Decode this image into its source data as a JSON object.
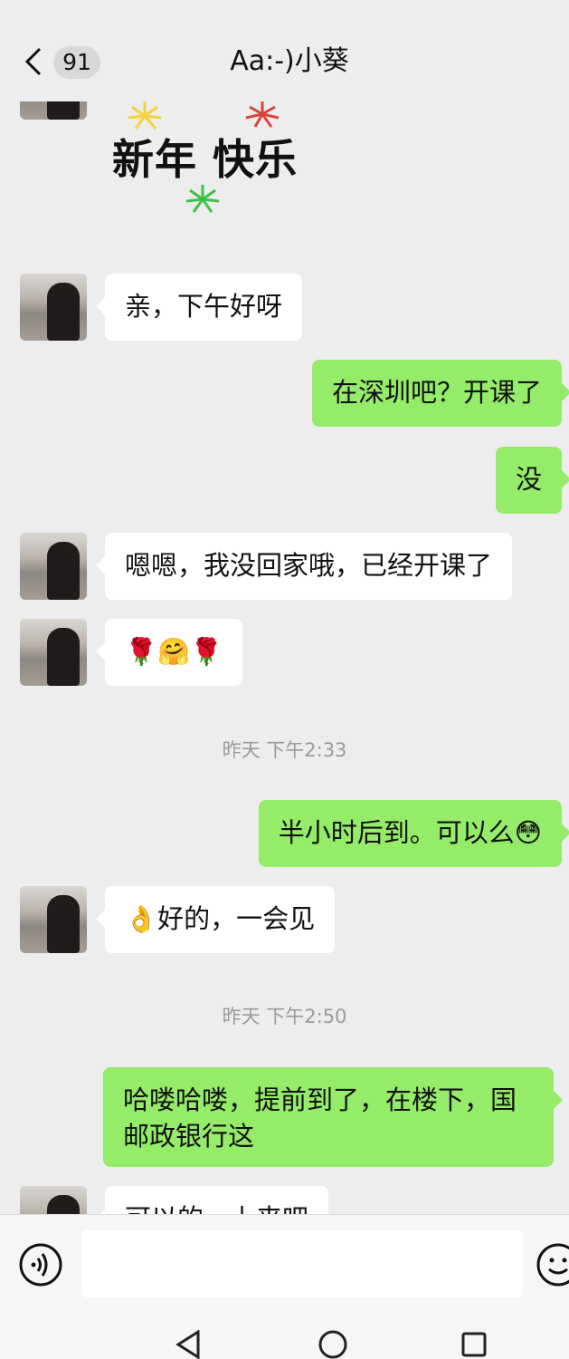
{
  "header": {
    "back_label": "<",
    "unread_count": "91",
    "title": "Aa:-)小葵"
  },
  "sticker": {
    "text": "新年 快乐"
  },
  "messages": [
    {
      "id": "m1",
      "side": "in",
      "text": "亲，下午好呀"
    },
    {
      "id": "m2",
      "side": "out",
      "text": "在深圳吧？开课了"
    },
    {
      "id": "m3",
      "side": "out",
      "text": "没"
    },
    {
      "id": "m4",
      "side": "in",
      "text": "嗯嗯，我没回家哦，已经开课了"
    },
    {
      "id": "m5",
      "side": "in",
      "text": "🌹🤗🌹"
    },
    {
      "id": "t1",
      "type": "timestamp",
      "text": "昨天 下午2:33"
    },
    {
      "id": "m6",
      "side": "out",
      "text": "半小时后到。可以么😳"
    },
    {
      "id": "m7",
      "side": "in",
      "text": "👌好的，一会见"
    },
    {
      "id": "t2",
      "type": "timestamp",
      "text": "昨天 下午2:50"
    },
    {
      "id": "m8",
      "side": "out",
      "line1": "哈喽哈喽，提前到了，在楼下，国",
      "line2": "邮政银行这"
    },
    {
      "id": "m9",
      "side": "in",
      "text": "可以的，上来吧"
    }
  ],
  "input": {
    "placeholder": ""
  },
  "icons": {
    "voice": "voice-icon",
    "emoji": "emoji-icon",
    "back": "chevron-left-icon",
    "nav_back": "triangle-back-icon",
    "nav_home": "circle-home-icon",
    "nav_recent": "square-recent-icon"
  },
  "colors": {
    "outgoing_bubble": "#95ec69",
    "incoming_bubble": "#ffffff",
    "background": "#ededed"
  }
}
